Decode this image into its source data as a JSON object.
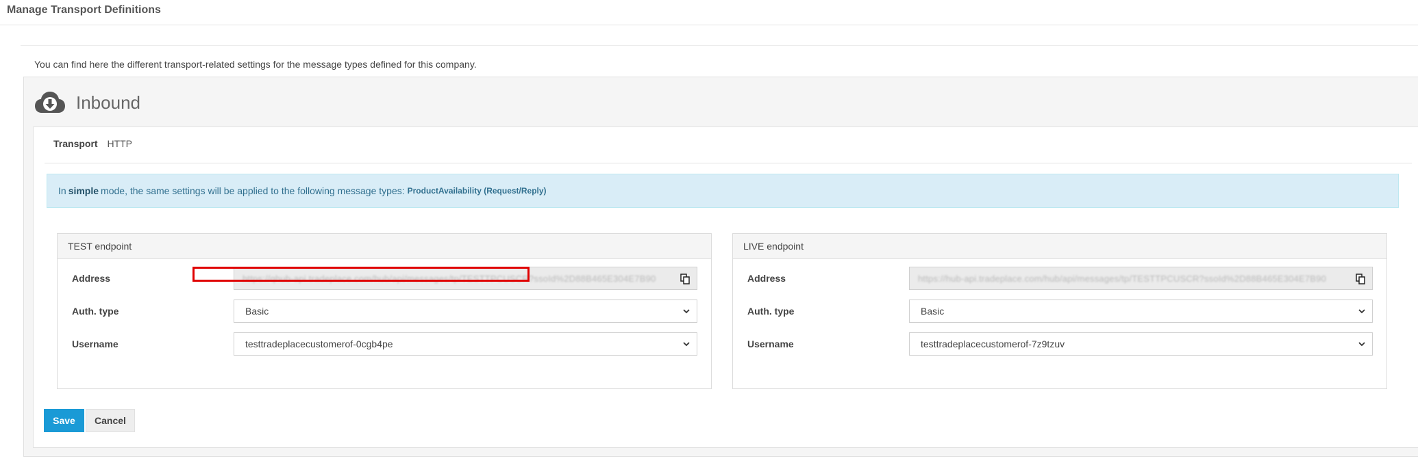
{
  "page": {
    "title": "Manage Transport Definitions",
    "intro": "You can find here the different transport-related settings for the message types defined for this company."
  },
  "inbound": {
    "title": "Inbound",
    "icon": "cloud-download-icon",
    "transport_label": "Transport",
    "transport_value": "HTTP",
    "info": {
      "prefix": "In",
      "mode": "simple",
      "middle": "mode, the same settings will be applied to the following message types:",
      "types": "ProductAvailability (Request/Reply)"
    }
  },
  "test_endpoint": {
    "header": "TEST endpoint",
    "address_label": "Address",
    "address_value": "https://qhub-api.tradeplace.com/hub/api/messages/tp/TESTTPCUSCR?ssoId%2D88B465E304E7B90",
    "auth_label": "Auth. type",
    "auth_value": "Basic",
    "username_label": "Username",
    "username_value": "testtradeplacecustomerof-0cgb4pe"
  },
  "live_endpoint": {
    "header": "LIVE endpoint",
    "address_label": "Address",
    "address_value": "https://hub-api.tradeplace.com/hub/api/messages/tp/TESTTPCUSCR?ssoId%2D88B465E304E7B90",
    "auth_label": "Auth. type",
    "auth_value": "Basic",
    "username_label": "Username",
    "username_value": "testtradeplacecustomerof-7z9tzuv"
  },
  "actions": {
    "save_label": "Save",
    "cancel_label": "Cancel"
  },
  "colors": {
    "primary_button": "#1a9ad6",
    "info_background": "#d9edf7",
    "highlight_border": "#e00000"
  }
}
